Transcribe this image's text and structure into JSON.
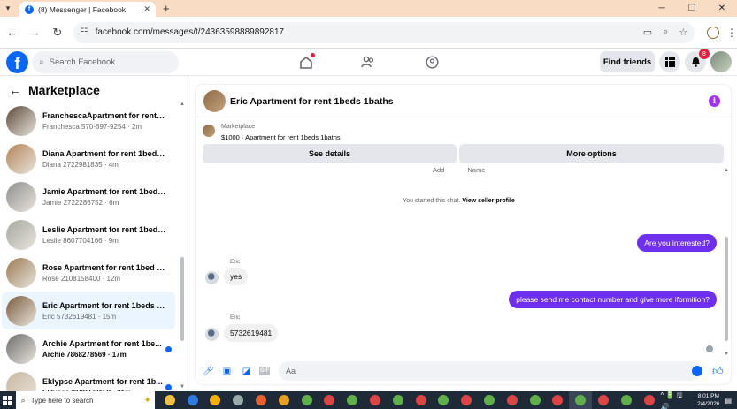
{
  "browser": {
    "tab_title": "(8) Messenger | Facebook",
    "url": "facebook.com/messages/t/24363598889892817",
    "tab_close": "✕",
    "new_tab": "+"
  },
  "fb": {
    "logo_letter": "f",
    "search_placeholder": "Search Facebook",
    "find_friends": "Find friends",
    "notification_count": "8"
  },
  "sidebar": {
    "title": "Marketplace",
    "items": [
      {
        "name": "FranchescaApartment for rent 3...",
        "sub": "Franchesca 570-697-9254 · 2m",
        "unread": false,
        "active": false,
        "thumb_color": "#5b4a3a"
      },
      {
        "name": "Diana Apartment for rent 1bed 1...",
        "sub": "Diana 2722981835 · 4m",
        "unread": false,
        "active": false,
        "thumb_color": "#b3845a"
      },
      {
        "name": "Jamie Apartment for rent 1bed 1...",
        "sub": "Jamie 2722286752 · 6m",
        "unread": false,
        "active": false,
        "thumb_color": "#8f8f8f"
      },
      {
        "name": "Leslie Apartment for rent 1bed 1...",
        "sub": "Leslie 8607704166 · 9m",
        "unread": false,
        "active": false,
        "thumb_color": "#a5a8a0"
      },
      {
        "name": "Rose Apartment for rent 1bed 1...",
        "sub": "Rose 2108158400 · 12m",
        "unread": false,
        "active": false,
        "thumb_color": "#9a7b55"
      },
      {
        "name": "Eric Apartment for rent 1beds 1...",
        "sub": "Eric 5732619481 · 15m",
        "unread": false,
        "active": true,
        "thumb_color": "#7a5a3c"
      },
      {
        "name": "Archie Apartment for rent 1be...",
        "sub": "Archie 7868278569 · 17m",
        "unread": true,
        "active": false,
        "thumb_color": "#6d6d6d"
      },
      {
        "name": "Eklypse Apartment for rent 1b...",
        "sub": "Eklypse 2109072159 · 21m",
        "unread": true,
        "active": false,
        "thumb_color": "#c7b7a0"
      }
    ]
  },
  "chat": {
    "title": "Eric Apartment for rent 1beds 1baths",
    "listing_source": "Marketplace",
    "listing_price": "$1000 · Apartment for rent 1beds 1baths",
    "see_details": "See details",
    "more_options": "More options",
    "cut_label_1": "Add",
    "cut_label_2": "Name",
    "started_text": "You started this chat.",
    "seller_link": "View seller profile",
    "messages": [
      {
        "dir": "out",
        "text": "Are you interested?"
      },
      {
        "dir": "in",
        "sender": "Eric",
        "text": "yes"
      },
      {
        "dir": "out",
        "text": "please send me contact number and give more iformition?"
      },
      {
        "dir": "in",
        "sender": "Eric",
        "text": "5732619481"
      }
    ],
    "composer_placeholder": "Aa"
  },
  "taskbar": {
    "search_placeholder": "Type here to search",
    "time": "8:01 PM",
    "date": "2/4/2026",
    "tray_text": "^ 🔋 🖫 🔊",
    "apps": [
      "#f0c040",
      "#2d7be0",
      "#f6b000",
      "#9aa",
      "#e8612c",
      "#e8a020",
      "#5fb04a",
      "#d44",
      "#5fb04a",
      "#d44",
      "#5fb04a",
      "#d44",
      "#5fb04a",
      "#d44",
      "#5fb04a",
      "#d44",
      "#5fb04a",
      "#d44",
      "#5fb04a",
      "#d44",
      "#5fb04a",
      "#d44"
    ]
  }
}
